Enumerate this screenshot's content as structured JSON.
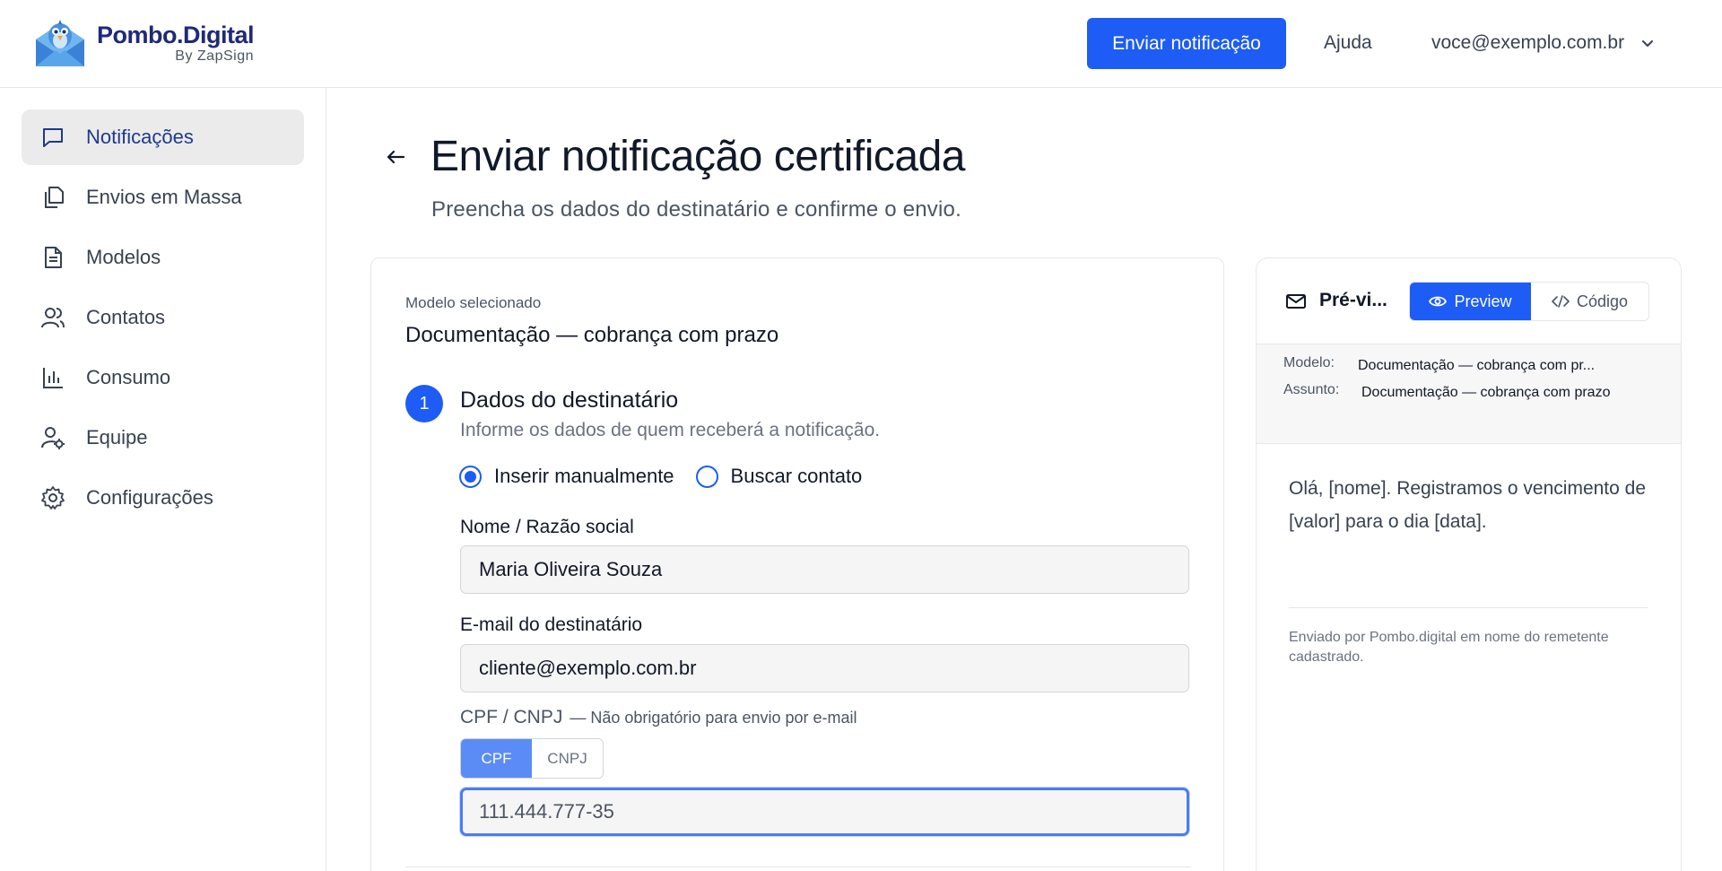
{
  "brand": {
    "name": "Pombo.Digital",
    "sub": "By ZapSign"
  },
  "header": {
    "send_label": "Enviar notificação",
    "help_label": "Ajuda",
    "user_email": "voce@exemplo.com.br"
  },
  "sidebar": {
    "items": [
      {
        "label": "Notificações",
        "icon": "chat-bubble-icon",
        "active": true
      },
      {
        "label": "Envios em Massa",
        "icon": "copy-documents-icon"
      },
      {
        "label": "Modelos",
        "icon": "document-icon"
      },
      {
        "label": "Contatos",
        "icon": "users-icon"
      },
      {
        "label": "Consumo",
        "icon": "bar-chart-icon"
      },
      {
        "label": "Equipe",
        "icon": "user-gear-icon"
      },
      {
        "label": "Configurações",
        "icon": "gear-icon"
      }
    ]
  },
  "page": {
    "title": "Enviar notificação certificada",
    "subtitle": "Preencha os dados do destinatário e confirme o envio."
  },
  "form": {
    "selected_model_label": "Modelo selecionado",
    "selected_model_value": "Documentação — cobrança com prazo",
    "step_number": "1",
    "step_title": "Dados do destinatário",
    "step_subtitle": "Informe os dados de quem receberá a notificação.",
    "radio_manual": "Inserir manualmente",
    "radio_search": "Buscar contato",
    "name_label": "Nome / Razão social",
    "name_value": "Maria Oliveira Souza",
    "email_label": "E-mail do destinatário",
    "email_value": "cliente@exemplo.com.br",
    "doc_label": "CPF / CNPJ",
    "doc_note": "— Não obrigatório para envio por e-mail",
    "doc_type_cpf": "CPF",
    "doc_type_cnpj": "CNPJ",
    "doc_value": "111.444.777-35"
  },
  "preview": {
    "title": "Pré-vi...",
    "tab_preview": "Preview",
    "tab_code": "Código",
    "model_key": "Modelo:",
    "model_value": "Documentação — cobrança com pr...",
    "subject_key": "Assunto:",
    "subject_value": "Documentação — cobrança com prazo",
    "body": "Olá, [nome]. Registramos o vencimento de [valor] para o dia [data].",
    "footer": "Enviado por Pombo.digital em nome do remetente cadastrado."
  },
  "colors": {
    "primary": "#1d5cf5",
    "brand_text": "#1e2a78",
    "active_nav_bg": "#ebebeb"
  }
}
